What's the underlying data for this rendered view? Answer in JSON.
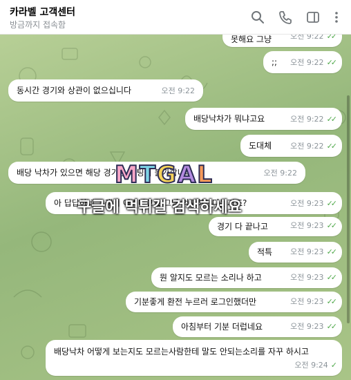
{
  "header": {
    "title": "카라벨 고객센터",
    "status": "방금까지 접속함"
  },
  "icons": [
    "search-icon",
    "phone-icon",
    "sidebar-toggle-icon",
    "more-menu-icon"
  ],
  "colors": {
    "accent": "#4fa84a",
    "bubble": "#ffffff",
    "background": "#a5c284"
  },
  "messages": [
    {
      "text": "못해요 그냥",
      "time": "오전 9:22",
      "check": "✓✓"
    },
    {
      "text": ";;",
      "time": "오전 9:22",
      "check": "✓✓"
    },
    {
      "text": "동시간 경기와 상관이 없으십니다",
      "time": "오전 9:22"
    },
    {
      "text": "배당낙차가 뭐냐고요",
      "time": "오전 9:22",
      "check": "✓✓"
    },
    {
      "text": "도대체",
      "time": "오전 9:22",
      "check": "✓✓"
    },
    {
      "text": "배당 낙차가 있으면 해당 경기는 배팅이 불가합니다",
      "time": "오전 9:22"
    },
    {
      "text": "아 답답하네 그래서 어쩌다고요 그냥 먹튀하신다는거죠?",
      "time": "오전 9:23",
      "check": "✓✓"
    },
    {
      "text": "경기 다 끝나고",
      "time": "오전 9:23",
      "check": "✓✓"
    },
    {
      "text": "적특",
      "time": "오전 9:23",
      "check": "✓✓"
    },
    {
      "text": "뭔 알지도 모르는 소리나 하고",
      "time": "오전 9:23",
      "check": "✓✓"
    },
    {
      "text": "기분좋게 환전 누르러 로그인했더만",
      "time": "오전 9:23",
      "check": "✓✓"
    },
    {
      "text": "아침부터 기분 더럽네요",
      "time": "오전 9:23",
      "check": "✓✓"
    },
    {
      "text": "배당낙차 어떻게 보는지도 모르는사람한테 말도 안되는소리를 자꾸 하시고",
      "time": "오전 9:24",
      "check": "✓"
    }
  ],
  "watermark": {
    "logo": "MTGAL",
    "caption": "구글에 먹튀갤 검색하세요"
  }
}
